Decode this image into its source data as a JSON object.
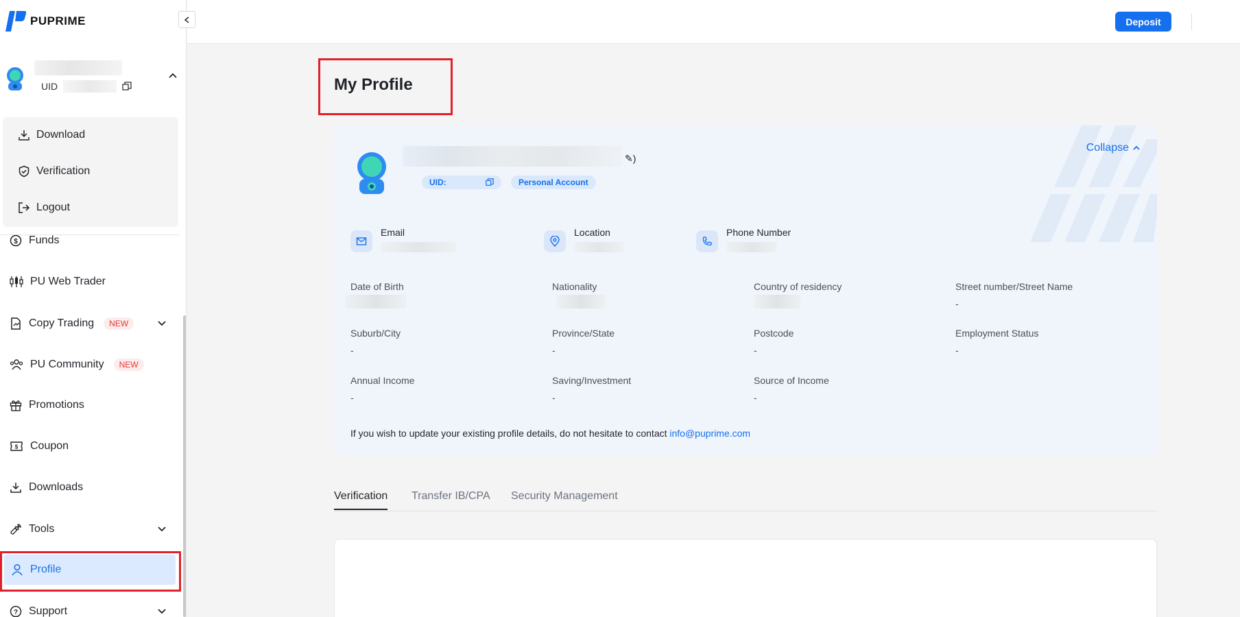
{
  "app": {
    "brand": "PUPRIME"
  },
  "user": {
    "uid_label": "UID"
  },
  "dropdown": {
    "items": [
      {
        "label": "Download",
        "icon": "download-icon"
      },
      {
        "label": "Verification",
        "icon": "shield-check-icon"
      },
      {
        "label": "Logout",
        "icon": "logout-icon"
      }
    ]
  },
  "nav": {
    "items": [
      {
        "label": "Funds",
        "icon": "dollar-circle-icon"
      },
      {
        "label": "PU Web Trader",
        "icon": "candlestick-icon"
      },
      {
        "label": "Copy Trading",
        "badge": "NEW",
        "icon": "copy-trading-icon",
        "expandable": true
      },
      {
        "label": "PU Community",
        "badge": "NEW",
        "icon": "community-icon"
      },
      {
        "label": "Promotions",
        "icon": "gift-icon"
      },
      {
        "label": "Coupon",
        "icon": "coupon-icon"
      },
      {
        "label": "Downloads",
        "icon": "download-icon"
      },
      {
        "label": "Tools",
        "icon": "wrench-icon",
        "expandable": true
      },
      {
        "label": "Profile",
        "icon": "user-icon",
        "active": true
      },
      {
        "label": "Support",
        "icon": "help-icon",
        "expandable": true
      }
    ]
  },
  "topbar": {
    "deposit_label": "Deposit"
  },
  "page": {
    "title": "My Profile"
  },
  "profile": {
    "uid_chip": "UID:",
    "account_type": "Personal Account",
    "collapse_label": "Collapse",
    "contacts": [
      {
        "label": "Email",
        "icon": "mail-icon"
      },
      {
        "label": "Location",
        "icon": "location-pin-icon"
      },
      {
        "label": "Phone Number",
        "icon": "phone-icon"
      }
    ],
    "fields": [
      {
        "label": "Date of Birth",
        "value": ""
      },
      {
        "label": "Nationality",
        "value": ""
      },
      {
        "label": "Country of residency",
        "value": ""
      },
      {
        "label": "Street number/Street Name",
        "value": "-"
      },
      {
        "label": "Suburb/City",
        "value": "-"
      },
      {
        "label": "Province/State",
        "value": "-"
      },
      {
        "label": "Postcode",
        "value": "-"
      },
      {
        "label": "Employment Status",
        "value": "-"
      },
      {
        "label": "Annual Income",
        "value": "-"
      },
      {
        "label": "Saving/Investment",
        "value": "-"
      },
      {
        "label": "Source of Income",
        "value": "-"
      }
    ],
    "notice_text": "If you wish to update your existing profile details, do not hesitate to contact ",
    "notice_email": "info@puprime.com"
  },
  "tabs": [
    {
      "label": "Verification",
      "active": true
    },
    {
      "label": "Transfer IB/CPA"
    },
    {
      "label": "Security Management"
    }
  ],
  "colors": {
    "accent": "#1570ef",
    "highlight_box": "#e0202a",
    "active_nav_bg": "#dbeafe"
  }
}
